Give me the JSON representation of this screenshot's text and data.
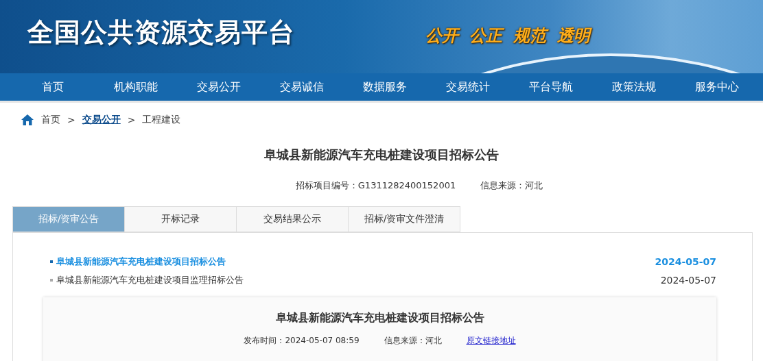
{
  "header": {
    "title": "全国公共资源交易平台",
    "slogan": [
      "公开",
      "公正",
      "规范",
      "透明"
    ]
  },
  "nav": [
    {
      "label": "首页"
    },
    {
      "label": "机构职能"
    },
    {
      "label": "交易公开"
    },
    {
      "label": "交易诚信"
    },
    {
      "label": "数据服务"
    },
    {
      "label": "交易统计"
    },
    {
      "label": "平台导航"
    },
    {
      "label": "政策法规"
    },
    {
      "label": "服务中心"
    }
  ],
  "breadcrumb": [
    {
      "kind": "home",
      "label": "首页"
    },
    {
      "kind": "sep",
      "label": ">"
    },
    {
      "kind": "link",
      "label": "交易公开"
    },
    {
      "kind": "sep",
      "label": ">"
    },
    {
      "kind": "current",
      "label": "工程建设"
    }
  ],
  "project": {
    "title": "阜城县新能源汽车充电桩建设项目招标公告",
    "meta": [
      "招标项目编号：G1311282400152001",
      "信息来源：河北"
    ]
  },
  "tabs": [
    {
      "label": "招标/资审公告",
      "selected": true
    },
    {
      "label": "开标记录",
      "selected": false
    },
    {
      "label": "交易结果公示",
      "selected": false
    },
    {
      "label": "招标/资审文件澄清",
      "selected": false
    }
  ],
  "notices": [
    {
      "title": "阜城县新能源汽车充电桩建设项目招标公告",
      "date": "2024-05-07",
      "selected": true
    },
    {
      "title": "阜城县新能源汽车充电桩建设项目监理招标公告",
      "date": "2024-05-07",
      "selected": false
    }
  ],
  "article": {
    "title": "阜城县新能源汽车充电桩建设项目招标公告",
    "meta": [
      "发布时间：2024-05-07 08:59",
      "信息来源：河北"
    ],
    "link": "原文链接地址"
  }
}
